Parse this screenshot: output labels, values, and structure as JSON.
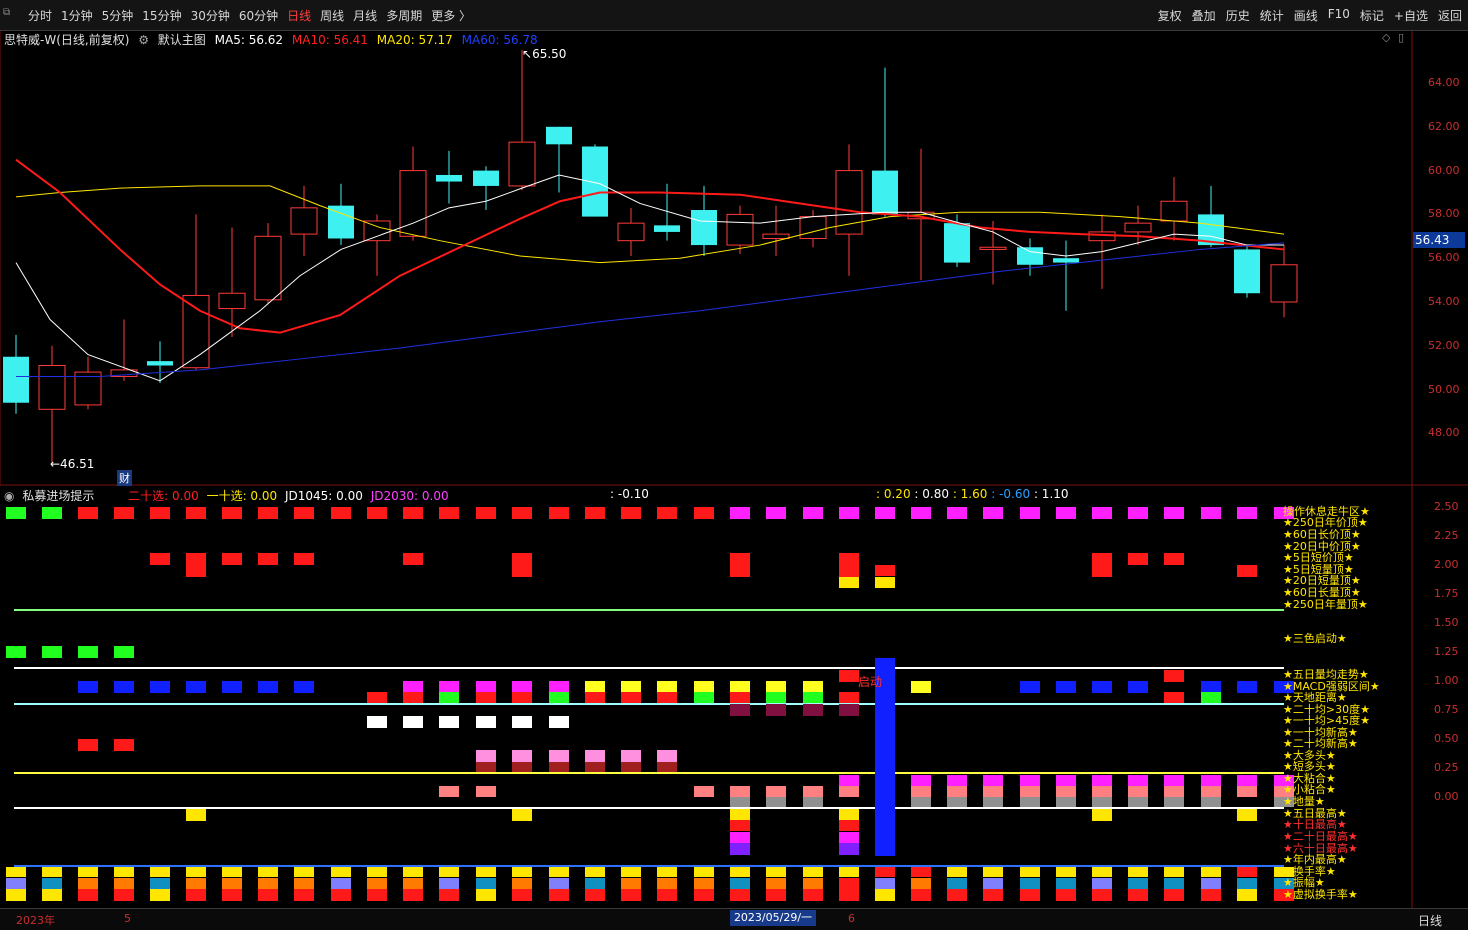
{
  "toolbar": {
    "periods": [
      "分时",
      "1分钟",
      "5分钟",
      "15分钟",
      "30分钟",
      "60分钟",
      "日线",
      "周线",
      "月线",
      "多周期",
      "更多 〉"
    ],
    "active_period": "日线",
    "tools": [
      "复权",
      "叠加",
      "历史",
      "统计",
      "画线",
      "F10",
      "标记",
      "+自选",
      "返回"
    ]
  },
  "header": {
    "stock": "思特威-W(日线,前复权)",
    "template": "默认主图",
    "ma5": "MA5: 56.62",
    "ma10": "MA10: 56.41",
    "ma20": "MA20: 57.17",
    "ma60": "MA60: 56.78",
    "colors": {
      "ma5": "#ffffff",
      "ma10": "#ff2020",
      "ma20": "#ffe600",
      "ma60": "#2040ff"
    }
  },
  "price_axis": {
    "ticks": [
      "64.00",
      "62.00",
      "60.00",
      "58.00",
      "56.00",
      "54.00",
      "52.00",
      "50.00",
      "48.00"
    ],
    "current": "56.43"
  },
  "callouts": {
    "high": "65.50",
    "low": "←46.51",
    "fin": "财"
  },
  "indicator": {
    "name": "私募进场提示",
    "s1": "二十选: 0.00",
    "s2": "一十选: 0.00",
    "s3": "JD1045: 0.00",
    "s4": "JD2030: 0.00",
    "s5": ": -0.10",
    "s6a": ": 0.20",
    "s6b": ": 0.80",
    "s6c": ": 1.60",
    "s6d": ": -0.60",
    "s6e": ": 1.10",
    "ticks": [
      "2.50",
      "2.25",
      "2.00",
      "1.75",
      "1.50",
      "1.25",
      "1.00",
      "0.75",
      "0.50",
      "0.25",
      "0.00"
    ],
    "labels": [
      "操作休息走牛区★",
      "★250日年价顶★",
      "★60日长价顶★",
      "★20日中价顶★",
      "★5日短价顶★",
      "★5日短量顶★",
      "★20日短量顶★",
      "★60日长量顶★",
      "★250日年量顶★",
      "★三色启动★",
      "★五日量均走势★",
      "★MACD强弱区间★",
      "★天地距离★",
      "★二十均>30度★",
      "★一十均>45度★",
      "★一十均新高★",
      "★二十均新高★",
      "★大多头★",
      "★短多头★",
      "★大粘合★",
      "★小粘合★",
      "★地量★",
      "★五日最高★",
      "★十日最高★",
      "★二十日最高★",
      "★六十日最高★",
      "★年内最高★",
      "★换手率★",
      "★振幅★",
      "★虚拟换手率★"
    ],
    "tag": "启动"
  },
  "timeline": {
    "year": "2023年",
    "m5": "5",
    "m6": "6",
    "date": "2023/05/29/一",
    "period": "日线"
  }
}
